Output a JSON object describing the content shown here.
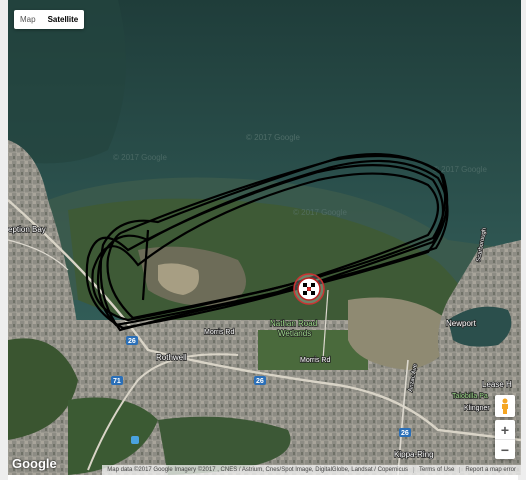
{
  "map_type_control": {
    "map_label": "Map",
    "satellite_label": "Satellite",
    "active": "Satellite"
  },
  "logo": "Google",
  "watermarks": [
    "© 2017 Google",
    "© 2017 Google",
    "© 2017 Google",
    "© 2017 Google"
  ],
  "place_labels": {
    "deception_bay": "eption Bay",
    "nathan_road_wetlands_1": "Nathan Road",
    "nathan_road_wetlands_2": "Wetlands",
    "morris_rd_a": "Morris Rd",
    "morris_rd_b": "Morris Rd",
    "rothwell": "Rothwell",
    "newport": "Newport",
    "lease_h": "Lease H",
    "talobilla": "Talobilla Pa",
    "klingner": "Klingner",
    "kippa_ring": "Kippa-Ring",
    "anzac": "Anzac Ave",
    "scarborough": "Scarborough",
    "road_26a": "26",
    "road_26b": "26",
    "road_26c": "26",
    "road_71": "71"
  },
  "attribution": {
    "text": "Map data ©2017 Google Imagery ©2017 , CNES / Astrium, Cnes/Spot Image, DigitalGlobe, Landsat / Copernicus",
    "terms": "Terms of Use",
    "report": "Report a map error"
  },
  "controls": {
    "zoom_in": "+",
    "zoom_out": "−"
  },
  "colors": {
    "track": "#000000",
    "water": "#2a4744",
    "land": "#3f5a3c",
    "urban": "#8a8a82"
  }
}
